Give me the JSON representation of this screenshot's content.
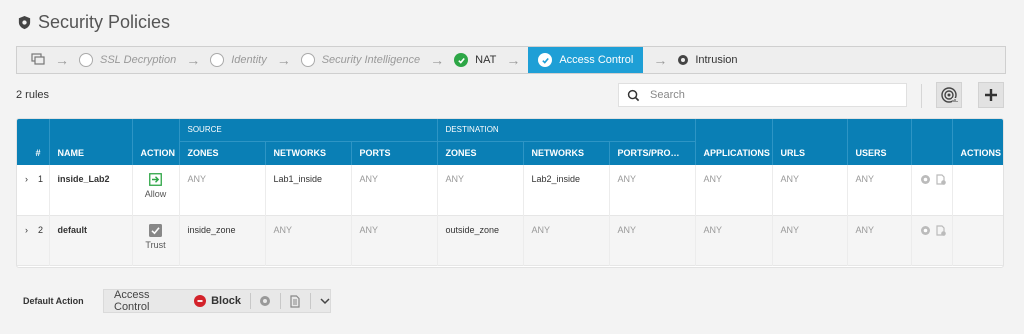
{
  "page": {
    "title": "Security Policies"
  },
  "pipeline": {
    "steps": [
      {
        "label": "SSL Decryption",
        "state": "pending"
      },
      {
        "label": "Identity",
        "state": "pending"
      },
      {
        "label": "Security Intelligence",
        "state": "pending"
      },
      {
        "label": "NAT",
        "state": "done"
      },
      {
        "label": "Access Control",
        "state": "active"
      },
      {
        "label": "Intrusion",
        "state": "plain"
      }
    ]
  },
  "toolbar": {
    "rule_count": "2 rules",
    "search_placeholder": "Search"
  },
  "table": {
    "group_headers": {
      "source": "SOURCE",
      "destination": "DESTINATION"
    },
    "columns": {
      "num": "#",
      "name": "NAME",
      "action": "ACTION",
      "src_zones": "ZONES",
      "src_networks": "NETWORKS",
      "src_ports": "PORTS",
      "dst_zones": "ZONES",
      "dst_networks": "NETWORKS",
      "dst_ports": "PORTS/PRO…",
      "applications": "APPLICATIONS",
      "urls": "URLS",
      "users": "USERS",
      "actions": "ACTIONS"
    },
    "rows": [
      {
        "num": "1",
        "name": "inside_Lab2",
        "action": "Allow",
        "src_zones": "ANY",
        "src_networks": "Lab1_inside",
        "src_ports": "ANY",
        "dst_zones": "ANY",
        "dst_networks": "Lab2_inside",
        "dst_ports": "ANY",
        "applications": "ANY",
        "urls": "ANY",
        "users": "ANY"
      },
      {
        "num": "2",
        "name": "default",
        "action": "Trust",
        "src_zones": "inside_zone",
        "src_networks": "ANY",
        "src_ports": "ANY",
        "dst_zones": "outside_zone",
        "dst_networks": "ANY",
        "dst_ports": "ANY",
        "applications": "ANY",
        "urls": "ANY",
        "users": "ANY"
      }
    ]
  },
  "default_action": {
    "label": "Default Action",
    "policy": "Access Control",
    "value": "Block"
  },
  "colors": {
    "header": "#0a7fb5",
    "active_step": "#1e9fd6",
    "success": "#2da646",
    "block": "#d3222a"
  }
}
